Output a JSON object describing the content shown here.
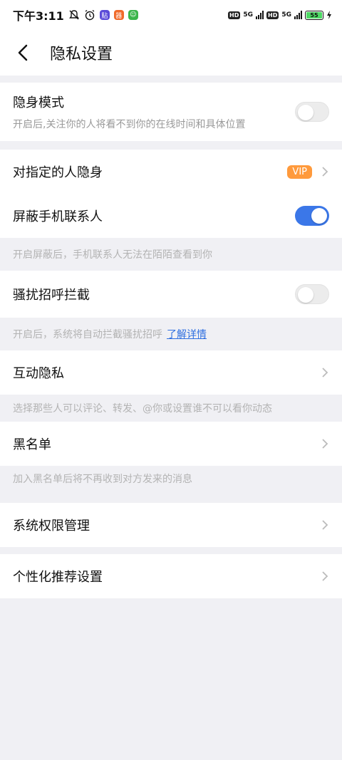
{
  "status": {
    "time": "下午3:11",
    "icon_labels": [
      "贴",
      "器",
      "☺"
    ],
    "net1": "5G",
    "net2": "5G",
    "hd": "HD",
    "battery": "55"
  },
  "header": {
    "title": "隐私设置"
  },
  "stealth": {
    "label": "隐身模式",
    "desc": "开启后,关注你的人将看不到你的在线时间和具体位置",
    "enabled": false
  },
  "hide_specific": {
    "label": "对指定的人隐身",
    "badge": "VIP"
  },
  "block_contacts": {
    "label": "屏蔽手机联系人",
    "enabled": true,
    "hint": "开启屏蔽后，手机联系人无法在陌陌查看到你"
  },
  "harass": {
    "label": "骚扰招呼拦截",
    "enabled": false,
    "hint": "开启后，系统将自动拦截骚扰招呼",
    "link": "了解详情"
  },
  "interaction": {
    "label": "互动隐私",
    "hint": "选择那些人可以评论、转发、@你或设置谁不可以看你动态"
  },
  "blacklist": {
    "label": "黑名单",
    "hint": "加入黑名单后将不再收到对方发来的消息"
  },
  "permissions": {
    "label": "系统权限管理"
  },
  "personalized": {
    "label": "个性化推荐设置"
  },
  "colors": {
    "accent": "#3b77e8",
    "vip": "#ff9a3c",
    "link": "#2f6fe0"
  }
}
